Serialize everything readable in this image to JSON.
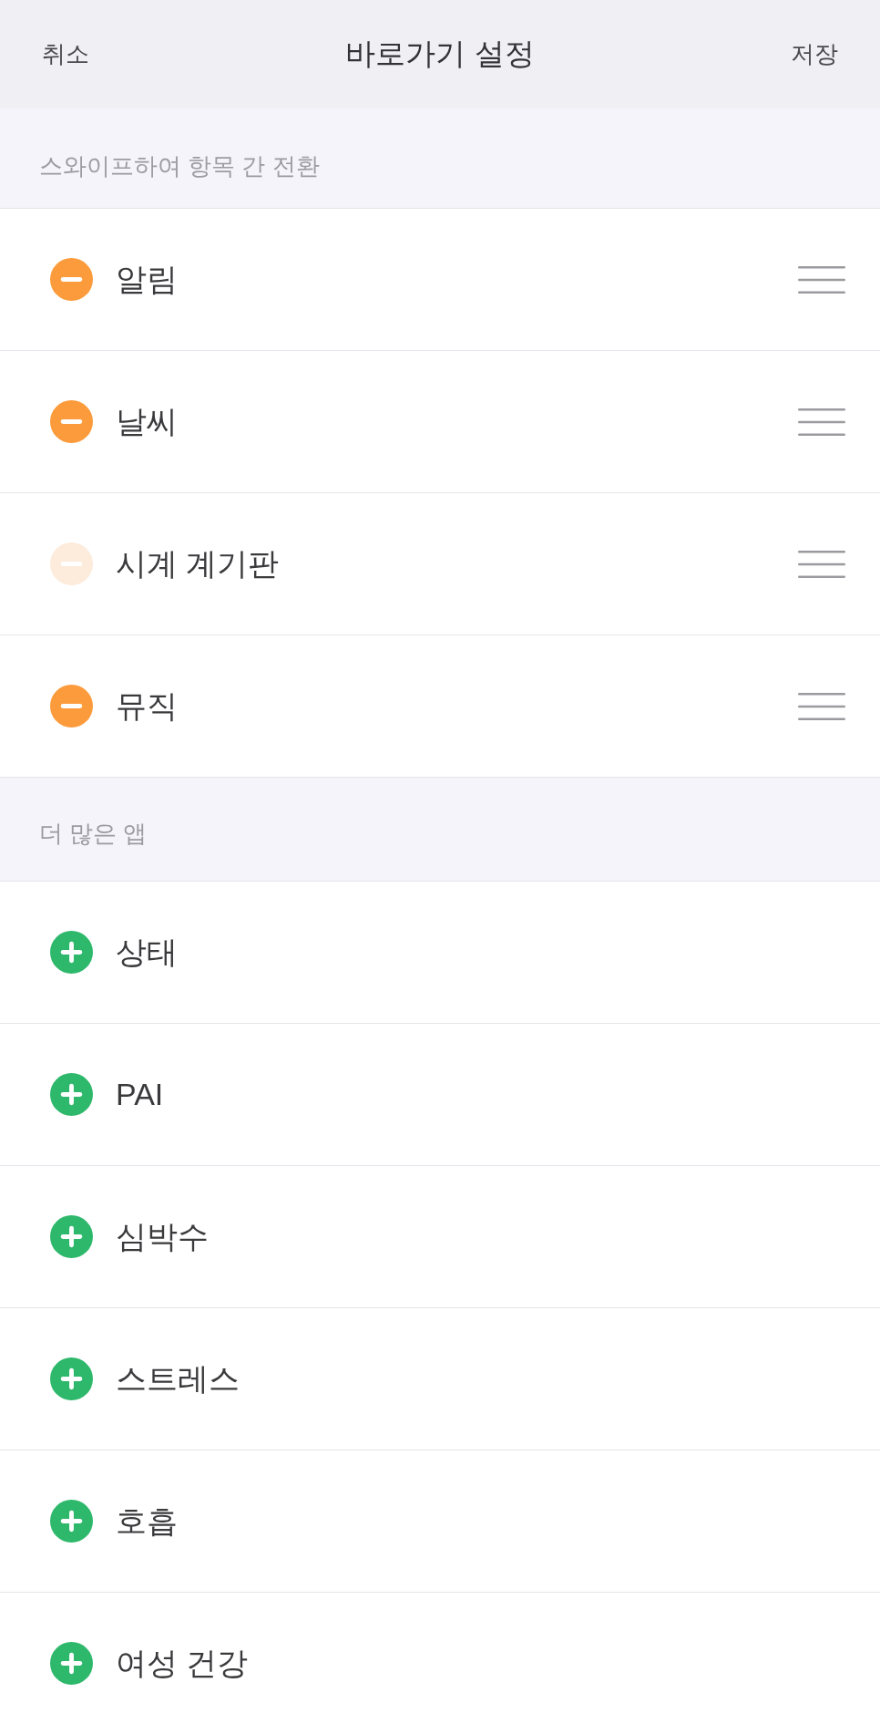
{
  "header": {
    "cancel": "취소",
    "title": "바로가기 설정",
    "save": "저장"
  },
  "sections": [
    {
      "title": "스와이프하여 항목 간 전환",
      "items": [
        {
          "label": "알림",
          "kind": "remove",
          "disabled": false
        },
        {
          "label": "날씨",
          "kind": "remove",
          "disabled": false
        },
        {
          "label": "시계 계기판",
          "kind": "remove",
          "disabled": true
        },
        {
          "label": "뮤직",
          "kind": "remove",
          "disabled": false
        }
      ]
    },
    {
      "title": "더 많은 앱",
      "items": [
        {
          "label": "상태",
          "kind": "add",
          "disabled": false
        },
        {
          "label": "PAI",
          "kind": "add",
          "disabled": false
        },
        {
          "label": "심박수",
          "kind": "add",
          "disabled": false
        },
        {
          "label": "스트레스",
          "kind": "add",
          "disabled": false
        },
        {
          "label": "호흡",
          "kind": "add",
          "disabled": false
        },
        {
          "label": "여성 건강",
          "kind": "add",
          "disabled": false
        }
      ]
    }
  ]
}
